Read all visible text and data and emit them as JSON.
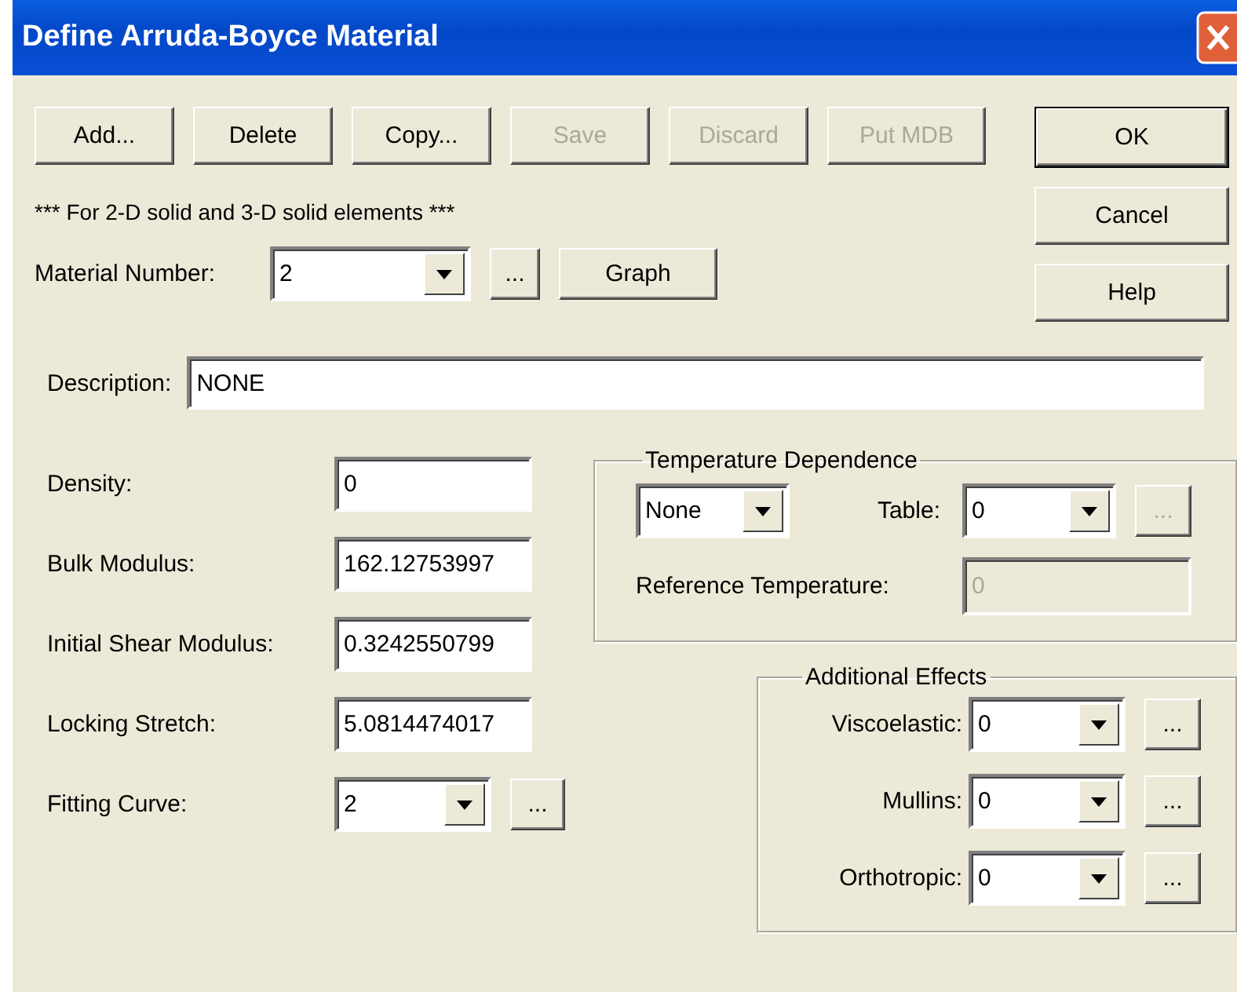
{
  "window": {
    "title": "Define Arruda-Boyce Material"
  },
  "toolbar_buttons": [
    {
      "label": "Add...",
      "disabled": false
    },
    {
      "label": "Delete",
      "disabled": false
    },
    {
      "label": "Copy...",
      "disabled": false
    },
    {
      "label": "Save",
      "disabled": true
    },
    {
      "label": "Discard",
      "disabled": true
    },
    {
      "label": "Put MDB",
      "disabled": true
    }
  ],
  "dialog_buttons": [
    {
      "label": "OK",
      "default": true
    },
    {
      "label": "Cancel",
      "default": false
    },
    {
      "label": "Help",
      "default": false
    }
  ],
  "note": "*** For 2-D solid and 3-D solid elements ***",
  "material_number": {
    "label": "Material Number:",
    "value": "2",
    "browse": "...",
    "graph": "Graph"
  },
  "description": {
    "label": "Description:",
    "value": "NONE"
  },
  "properties": [
    {
      "kind": "text",
      "label": "Density:",
      "value": "0"
    },
    {
      "kind": "text",
      "label": "Bulk Modulus:",
      "value": "162.12753997"
    },
    {
      "kind": "text",
      "label": "Initial Shear Modulus:",
      "value": "0.3242550799"
    },
    {
      "kind": "text",
      "label": "Locking Stretch:",
      "value": "5.0814474017"
    },
    {
      "kind": "combo",
      "label": "Fitting Curve:",
      "value": "2",
      "browse": "..."
    }
  ],
  "temperature_dependence": {
    "title": "Temperature Dependence",
    "mode": "None",
    "table_label": "Table:",
    "table": "0",
    "table_browse": {
      "label": "...",
      "disabled": true
    },
    "reference_label": "Reference Temperature:",
    "reference": {
      "value": "0",
      "disabled": true
    }
  },
  "additional_effects": {
    "title": "Additional Effects",
    "rows": [
      {
        "label": "Viscoelastic:",
        "value": "0",
        "browse": "..."
      },
      {
        "label": "Mullins:",
        "value": "0",
        "browse": "..."
      },
      {
        "label": "Orthotropic:",
        "value": "0",
        "browse": "..."
      }
    ]
  }
}
